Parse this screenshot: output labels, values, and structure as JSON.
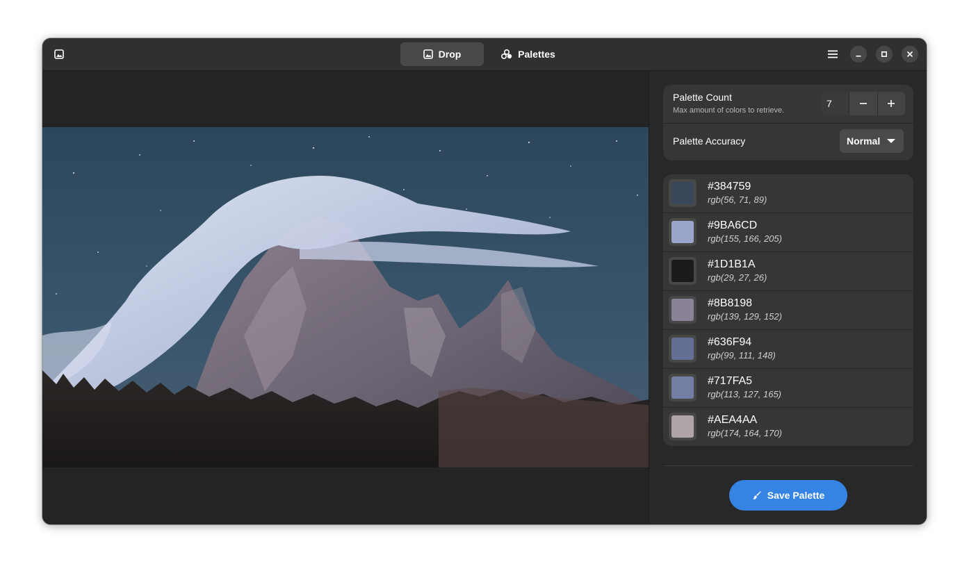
{
  "window": {
    "app_icon": "image-icon"
  },
  "tabs": [
    {
      "label": "Drop",
      "icon": "image-icon",
      "active": true
    },
    {
      "label": "Palettes",
      "icon": "palette-icon",
      "active": false
    }
  ],
  "header_controls": {
    "menu_icon": "hamburger-menu-icon",
    "minimize_icon": "minimize-icon",
    "maximize_icon": "maximize-icon",
    "close_icon": "close-icon"
  },
  "settings": {
    "palette_count": {
      "title": "Palette Count",
      "subtitle": "Max amount of colors to retrieve.",
      "value": "7"
    },
    "palette_accuracy": {
      "title": "Palette Accuracy",
      "value": "Normal"
    }
  },
  "colors": [
    {
      "hex": "#384759",
      "rgb": "rgb(56, 71, 89)"
    },
    {
      "hex": "#9BA6CD",
      "rgb": "rgb(155, 166, 205)"
    },
    {
      "hex": "#1D1B1A",
      "rgb": "rgb(29, 27, 26)"
    },
    {
      "hex": "#8B8198",
      "rgb": "rgb(139, 129, 152)"
    },
    {
      "hex": "#636F94",
      "rgb": "rgb(99, 111, 148)"
    },
    {
      "hex": "#717FA5",
      "rgb": "rgb(113, 127, 165)"
    },
    {
      "hex": "#AEA4AA",
      "rgb": "rgb(174, 164, 170)"
    }
  ],
  "save_button": {
    "label": "Save Palette",
    "icon": "brush-icon",
    "color": "#3584e4"
  }
}
